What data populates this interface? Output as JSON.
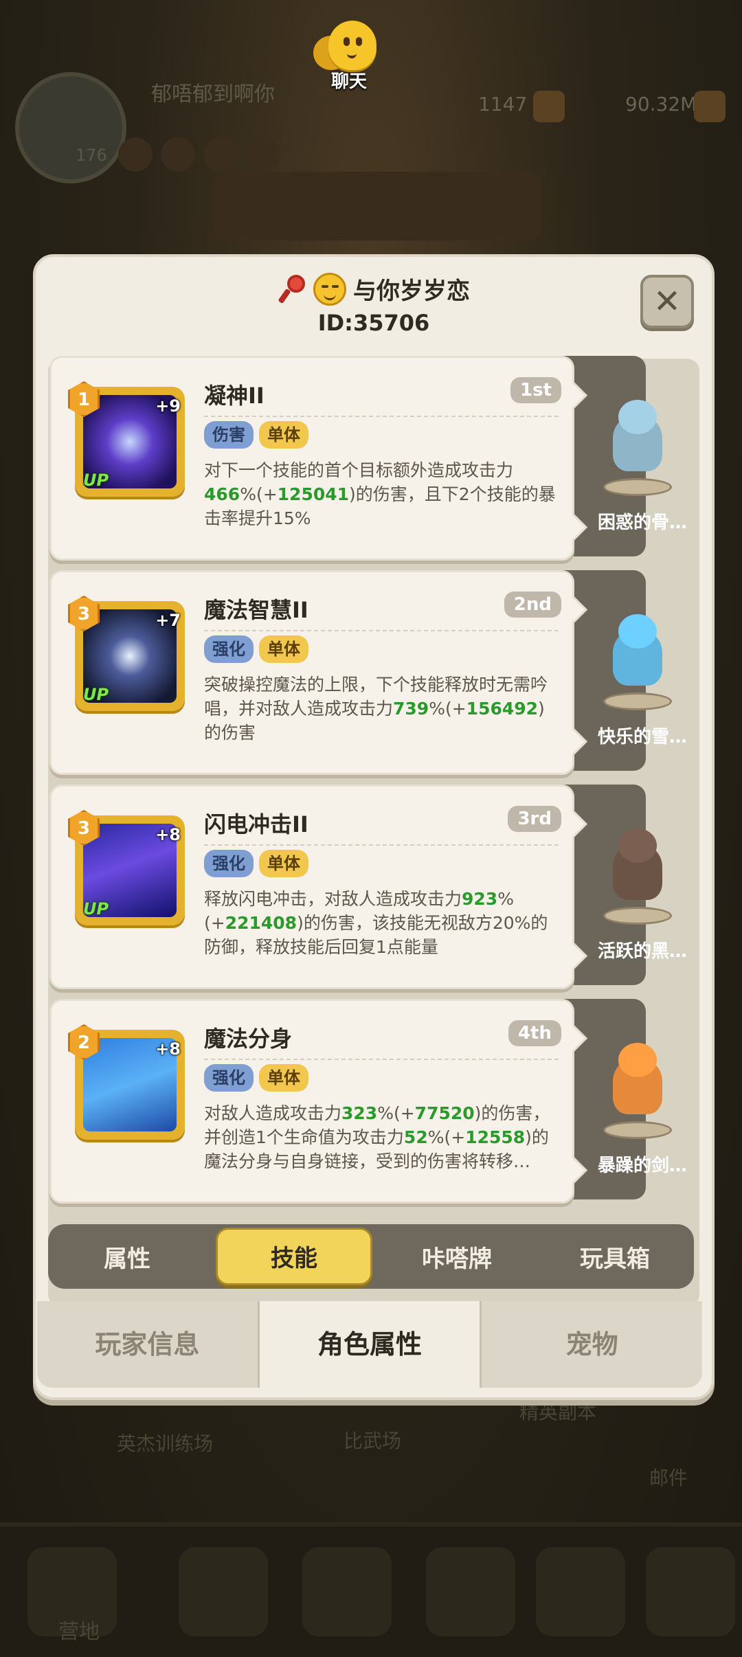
{
  "background": {
    "player_name": "郁唔郁到啊你",
    "player_level": "176",
    "resource_1": "1147",
    "resource_2": "90.32M",
    "labels": [
      "英杰训练场",
      "比武场",
      "精英副本",
      "邮件",
      "营地"
    ]
  },
  "chat": {
    "label": "聊天"
  },
  "header": {
    "player_name": "与你岁岁恋",
    "player_id": "ID:35706",
    "close_icon": "close-icon"
  },
  "skills": [
    {
      "name": "凝神II",
      "order": "1st",
      "rank": "1",
      "plus": "+9",
      "up": "UP",
      "tags": [
        "伤害",
        "单体"
      ],
      "desc": [
        {
          "t": "对下一个技能的首个目标额外造成攻击力"
        },
        {
          "t": "466",
          "g": true
        },
        {
          "t": "%(+"
        },
        {
          "t": "125041",
          "g": true
        },
        {
          "t": ")的伤害，且下2个技能的暴击率提升15%"
        }
      ],
      "pet_name": "困惑的骨…",
      "pet_color": "#8fb6c8"
    },
    {
      "name": "魔法智慧II",
      "order": "2nd",
      "rank": "3",
      "plus": "+7",
      "up": "UP",
      "tags": [
        "强化",
        "单体"
      ],
      "desc": [
        {
          "t": "突破操控魔法的上限，下个技能释放时无需吟唱，并对敌人造成攻击力"
        },
        {
          "t": "739",
          "g": true
        },
        {
          "t": "%(+"
        },
        {
          "t": "156492",
          "g": true
        },
        {
          "t": ")的伤害"
        }
      ],
      "pet_name": "快乐的雪…",
      "pet_color": "#5fb5dd"
    },
    {
      "name": "闪电冲击II",
      "order": "3rd",
      "rank": "3",
      "plus": "+8",
      "up": "UP",
      "tags": [
        "强化",
        "单体"
      ],
      "desc": [
        {
          "t": "释放闪电冲击，对敌人造成攻击力"
        },
        {
          "t": "923",
          "g": true
        },
        {
          "t": "%(+"
        },
        {
          "t": "221408",
          "g": true
        },
        {
          "t": ")的伤害，该技能无视敌方20%的防御，释放技能后回复1点能量"
        }
      ],
      "pet_name": "活跃的黑…",
      "pet_color": "#6b5346"
    },
    {
      "name": "魔法分身",
      "order": "4th",
      "rank": "2",
      "plus": "+8",
      "up": "",
      "tags": [
        "强化",
        "单体"
      ],
      "desc": [
        {
          "t": "对敌人造成攻击力"
        },
        {
          "t": "323",
          "g": true
        },
        {
          "t": "%(+"
        },
        {
          "t": "77520",
          "g": true
        },
        {
          "t": ")的伤害，并创造1个生命值为攻击力"
        },
        {
          "t": "52",
          "g": true
        },
        {
          "t": "%(+"
        },
        {
          "t": "12558",
          "g": true
        },
        {
          "t": ")的魔法分身与自身链接，受到的伤害将转移…"
        }
      ],
      "pet_name": "暴躁的剑…",
      "pet_color": "#e58a3a"
    }
  ],
  "subtabs": [
    "属性",
    "技能",
    "咔嗒牌",
    "玩具箱"
  ],
  "subtab_active": 1,
  "maintabs": [
    "玩家信息",
    "角色属性",
    "宠物"
  ],
  "maintab_active": 1,
  "colors": {
    "accent_gold": "#f2d45a",
    "value_green": "#2a9a2a",
    "tag_blue": "#7f9fd2",
    "tag_gold": "#f1c74e"
  }
}
